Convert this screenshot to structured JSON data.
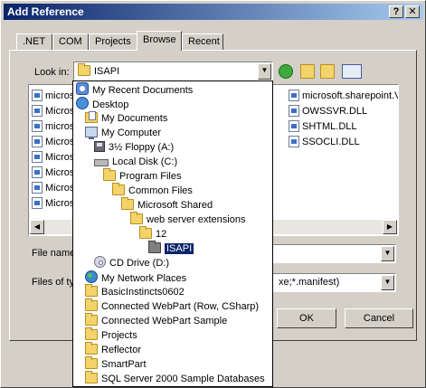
{
  "window": {
    "title": "Add Reference",
    "help_glyph": "?",
    "close_glyph": "✕"
  },
  "tabs": [
    ".NET",
    "COM",
    "Projects",
    "Browse",
    "Recent"
  ],
  "active_tab": "Browse",
  "look_in": {
    "label": "Look in:",
    "value": "ISAPI"
  },
  "files": {
    "left_column": [
      "microso",
      "Microso",
      "microso",
      "Microso",
      "Microso",
      "Microso",
      "Microso",
      "Microso"
    ],
    "right_column": [
      "microsoft.sharepoint.V",
      "OWSSVR.DLL",
      "SHTML.DLL",
      "SSOCLI.DLL"
    ]
  },
  "dropdown": {
    "items": [
      {
        "label": "My Recent Documents",
        "icon": "recent-documents-icon",
        "indent": 0
      },
      {
        "label": "Desktop",
        "icon": "desktop-icon",
        "indent": 0
      },
      {
        "label": "My Documents",
        "icon": "my-documents-icon",
        "indent": 1
      },
      {
        "label": "My Computer",
        "icon": "my-computer-icon",
        "indent": 1
      },
      {
        "label": "3½ Floppy (A:)",
        "icon": "floppy-drive-icon",
        "indent": 2
      },
      {
        "label": "Local Disk (C:)",
        "icon": "local-disk-icon",
        "indent": 2
      },
      {
        "label": "Program Files",
        "icon": "folder-icon",
        "indent": 3
      },
      {
        "label": "Common Files",
        "icon": "folder-icon",
        "indent": 4
      },
      {
        "label": "Microsoft Shared",
        "icon": "folder-icon",
        "indent": 5
      },
      {
        "label": "web server extensions",
        "icon": "folder-icon",
        "indent": 6
      },
      {
        "label": "12",
        "icon": "folder-icon",
        "indent": 7
      },
      {
        "label": "ISAPI",
        "icon": "open-folder-icon",
        "indent": 8,
        "selected": true
      },
      {
        "label": "CD Drive (D:)",
        "icon": "cd-drive-icon",
        "indent": 2
      },
      {
        "label": "My Network Places",
        "icon": "network-places-icon",
        "indent": 1
      },
      {
        "label": "BasicInstincts0602",
        "icon": "folder-icon",
        "indent": 1
      },
      {
        "label": "Connected WebPart (Row, CSharp)",
        "icon": "folder-icon",
        "indent": 1
      },
      {
        "label": "Connected WebPart Sample",
        "icon": "folder-icon",
        "indent": 1
      },
      {
        "label": "Projects",
        "icon": "folder-icon",
        "indent": 1
      },
      {
        "label": "Reflector",
        "icon": "folder-icon",
        "indent": 1
      },
      {
        "label": "SmartPart",
        "icon": "folder-icon",
        "indent": 1
      },
      {
        "label": "SQL Server 2000 Sample Databases",
        "icon": "folder-icon",
        "indent": 1
      }
    ]
  },
  "file_name": {
    "label": "File name",
    "value": ""
  },
  "files_of_type": {
    "label": "Files of ty",
    "value": "xe;*.manifest)"
  },
  "buttons": {
    "ok": "OK",
    "cancel": "Cancel"
  }
}
